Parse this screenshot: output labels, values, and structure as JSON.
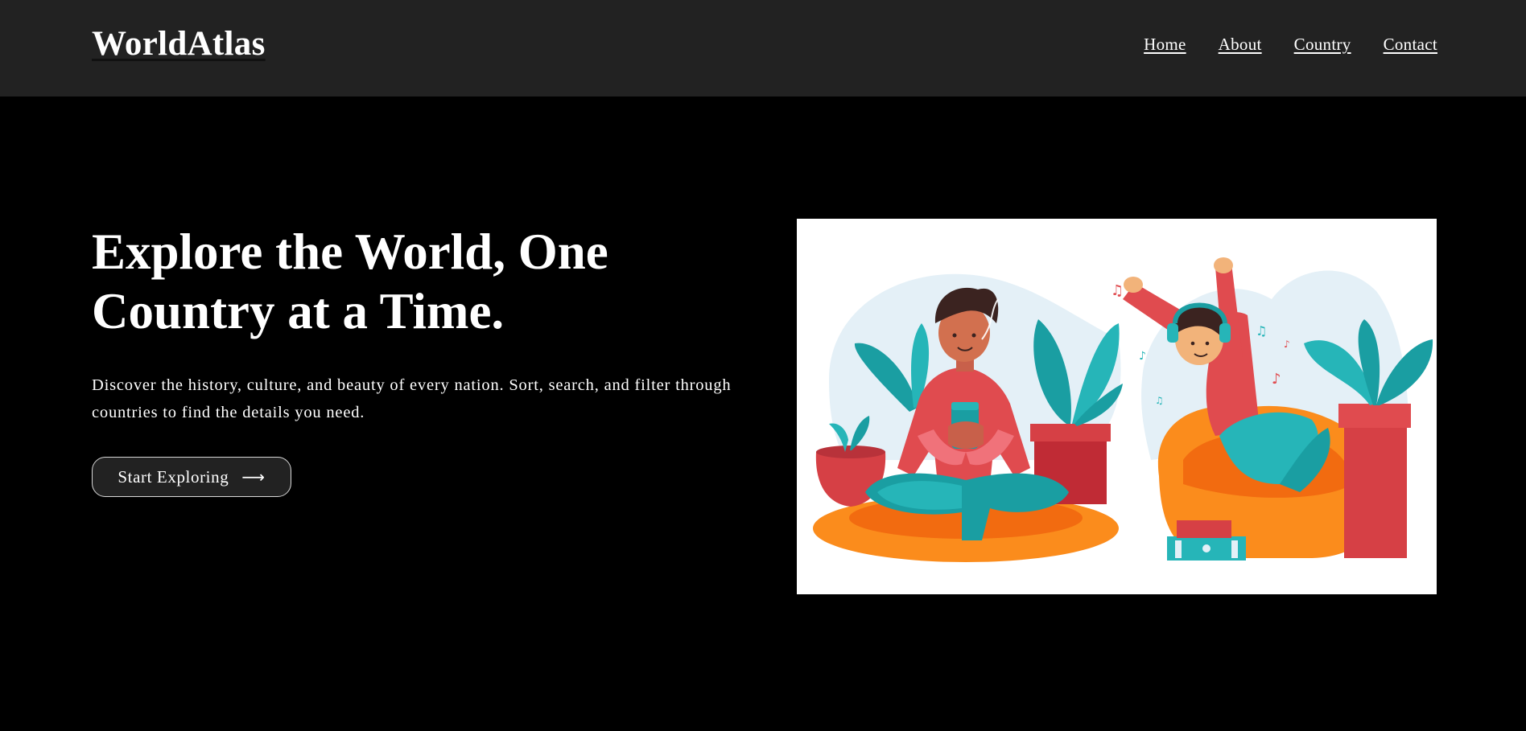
{
  "header": {
    "logo": "WorldAtlas",
    "nav": [
      "Home",
      "About",
      "Country",
      "Contact"
    ]
  },
  "hero": {
    "title": "Explore the World, One Country at a Time.",
    "description": "Discover the history, culture, and beauty of every nation. Sort, search, and filter through countries to find the details you need.",
    "cta_label": "Start Exploring",
    "cta_icon": "arrow-right-icon"
  },
  "colors": {
    "background": "#000000",
    "navbar": "#222222",
    "text": "#ffffff",
    "illustration_teal": "#26b5b8",
    "illustration_red": "#e04b4f",
    "illustration_orange": "#fb8c1c"
  }
}
